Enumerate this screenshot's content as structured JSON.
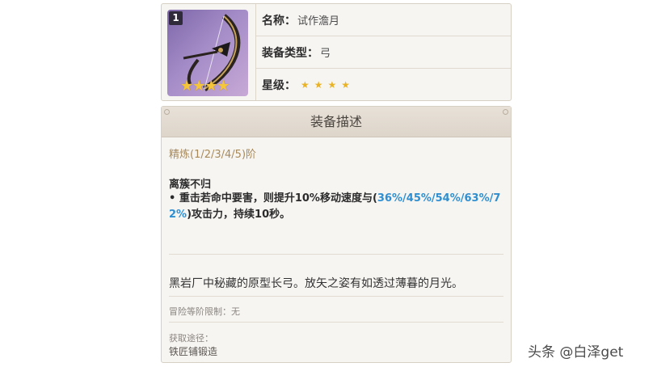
{
  "item": {
    "rank_badge": "1",
    "thumb_stars": "★★★★",
    "name_key": "名称：",
    "name_value": "试作澹月",
    "type_key": "装备类型：",
    "type_value": "弓",
    "rarity_key": "星级：",
    "rarity_value": "★★★★",
    "rarity_stars": 4
  },
  "description": {
    "header": "装备描述",
    "refinement": "精炼(1/2/3/4/5)阶",
    "passive_name": "离簇不归",
    "passive_prefix": "• 重击若命中要害，则提升10%移动速度与(",
    "passive_highlight": "36%/45%/54%/63%/72%",
    "passive_suffix": ")攻击力，持续10秒。",
    "lore": "黑岩厂中秘藏的原型长弓。放矢之姿有如透过薄暮的月光。",
    "level_limit": "冒险等阶限制：无",
    "source_label": "获取途径：",
    "source_value": "铁匠铺锻造"
  },
  "colors": {
    "highlight": "#2f8fd0",
    "star": "#e8b326",
    "refine": "#a88a5a",
    "thumb_bg": "#a48cc8"
  },
  "watermark": "头条 @白泽get"
}
